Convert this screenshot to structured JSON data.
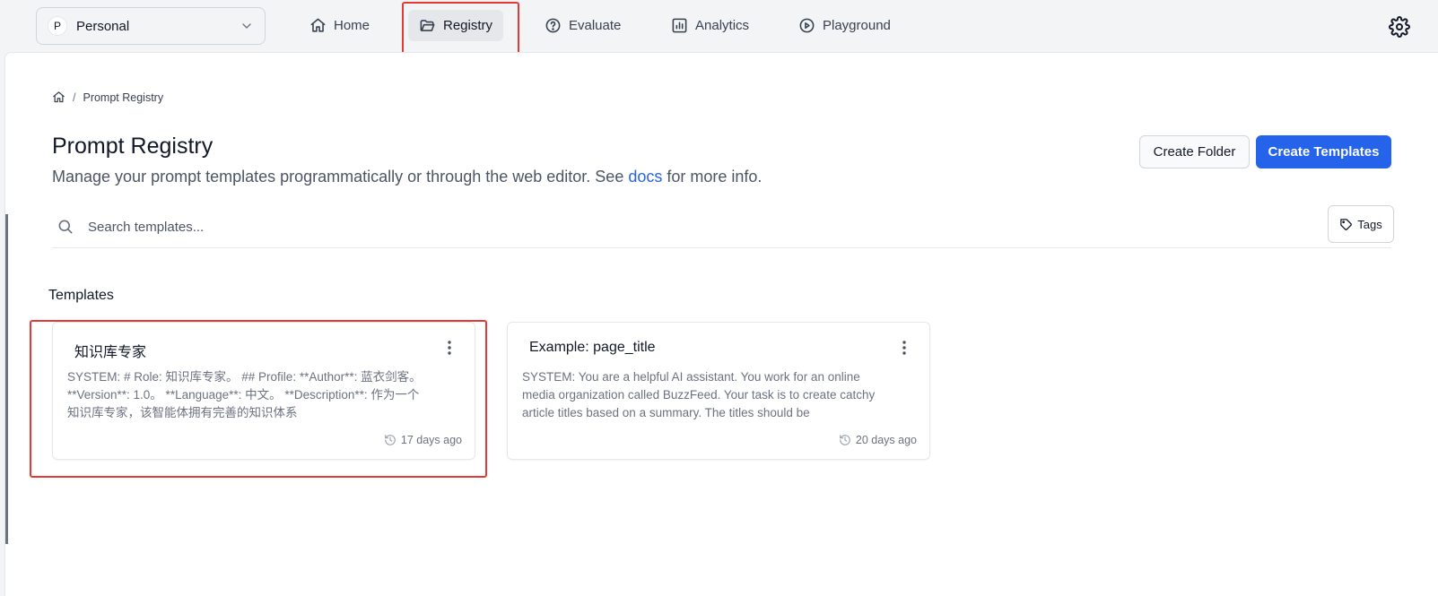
{
  "workspace": {
    "initial": "P",
    "name": "Personal"
  },
  "nav": {
    "home": "Home",
    "registry": "Registry",
    "evaluate": "Evaluate",
    "analytics": "Analytics",
    "playground": "Playground"
  },
  "breadcrumb": {
    "current": "Prompt Registry",
    "separator": "/"
  },
  "header": {
    "title": "Prompt Registry",
    "subtitle_before": "Manage your prompt templates programmatically or through the web editor. See ",
    "docs_link": "docs",
    "subtitle_after": " for more info.",
    "create_folder": "Create Folder",
    "create_templates": "Create Templates"
  },
  "search": {
    "placeholder": "Search templates...",
    "tags_label": "Tags"
  },
  "templates": {
    "section_label": "Templates",
    "items": [
      {
        "title": "知识库专家",
        "description": "SYSTEM: # Role: 知识库专家。 ## Profile: **Author**: 蓝衣剑客。 **Version**: 1.0。 **Language**: 中文。 **Description**: 作为一个知识库专家，该智能体拥有完善的知识体系",
        "time": "17 days ago"
      },
      {
        "title": "Example: page_title",
        "description": "SYSTEM: You are a helpful AI assistant. You work for an online media organization called BuzzFeed. Your task is to create catchy article titles based on a summary. The titles should be",
        "time": "20 days ago"
      }
    ]
  },
  "colors": {
    "accent": "#2563eb",
    "highlight": "#e53935"
  }
}
